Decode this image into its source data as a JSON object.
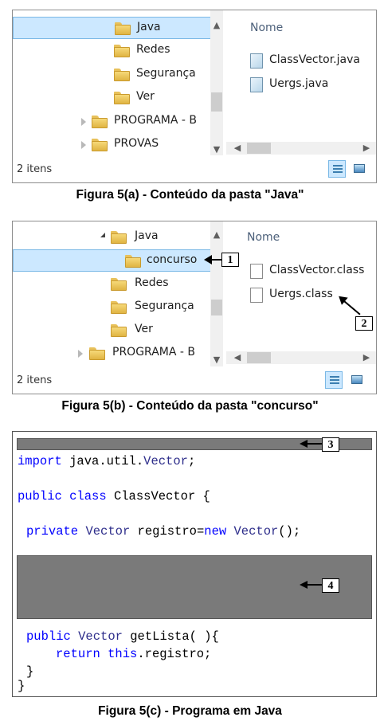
{
  "panel_a": {
    "tree_items": [
      {
        "label": "Java",
        "selected": true
      },
      {
        "label": "Redes"
      },
      {
        "label": "Segurança"
      },
      {
        "label": "Ver"
      },
      {
        "label": "PROGRAMA - B"
      },
      {
        "label": "PROVAS"
      }
    ],
    "column_header": "Nome",
    "files": [
      "ClassVector.java",
      "Uergs.java"
    ],
    "status": "2 itens",
    "caption": "Figura 5(a) - Conteúdo da pasta \"Java\""
  },
  "panel_b": {
    "tree_items": [
      {
        "label": "Java"
      },
      {
        "label": "concurso",
        "selected": true
      },
      {
        "label": "Redes"
      },
      {
        "label": "Segurança"
      },
      {
        "label": "Ver"
      },
      {
        "label": "PROGRAMA - B"
      }
    ],
    "column_header": "Nome",
    "files": [
      "ClassVector.class",
      "Uergs.class"
    ],
    "status": "2 itens",
    "caption": "Figura 5(b) - Conteúdo da pasta \"concurso\""
  },
  "panel_c": {
    "code": {
      "line1_kw": "import",
      "line1_rest": " java.util.",
      "line1_type": "Vector",
      "line1_end": ";",
      "line2_kw1": "public",
      "line2_kw2": "class",
      "line2_rest": " ClassVector {",
      "line3_kw": "private",
      "line3_type": "Vector",
      "line3_mid": " registro=",
      "line3_kw2": "new",
      "line3_type2": "Vector",
      "line3_end": "();",
      "line4_kw": "public",
      "line4_type": "Vector",
      "line4_rest": " getLista( ){",
      "line5_kw1": "return",
      "line5_kw2": "this",
      "line5_rest": ".registro;",
      "line6": "}",
      "line7": "}"
    },
    "caption": "Figura 5(c) - Programa em Java"
  },
  "callouts": [
    "1",
    "2",
    "3",
    "4"
  ],
  "icons": {
    "folder": "folder-icon",
    "file": "file-icon",
    "details_view": "details-view-icon",
    "thumbnail_view": "thumbnail-view-icon"
  }
}
